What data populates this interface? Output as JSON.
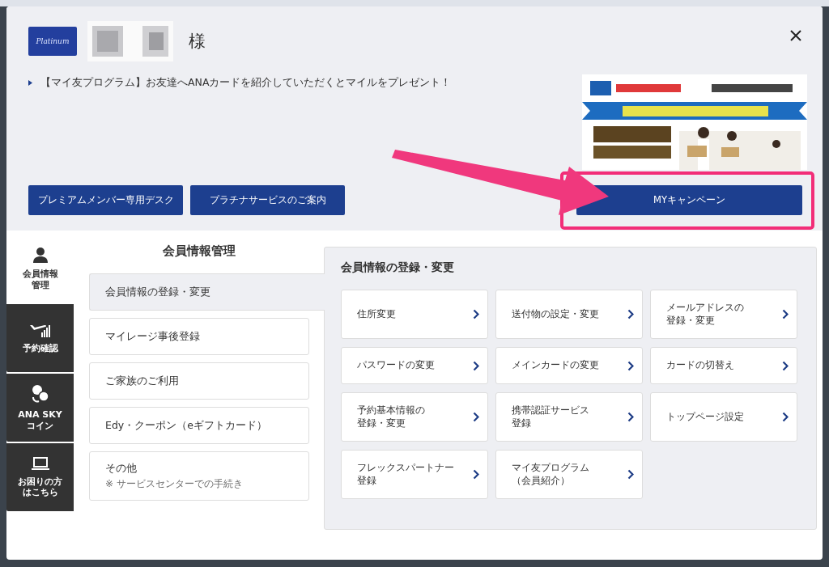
{
  "header": {
    "card_logo": "Platinum",
    "honorific": "様"
  },
  "notice": "【マイ友プログラム】お友達へANAカードを紹介していただくとマイルをプレゼント！",
  "top_buttons": [
    "プレミアムメンバー専用デスク",
    "プラチナサービスのご案内"
  ],
  "campaign_button": "MYキャンペーン",
  "side_tabs": [
    {
      "lines": [
        "会員情報",
        "管理"
      ],
      "kind": "person",
      "selected": true
    },
    {
      "lines": [
        "予約確認"
      ],
      "kind": "flight",
      "selected": false
    },
    {
      "lines": [
        "ANA SKY",
        "コイン"
      ],
      "kind": "coin",
      "selected": false
    },
    {
      "lines": [
        "お困りの方",
        "はこちら"
      ],
      "kind": "laptop",
      "selected": false
    }
  ],
  "menu": {
    "title": "会員情報管理",
    "items": [
      {
        "label": "会員情報の登録・変更",
        "selected": true
      },
      {
        "label": "マイレージ事後登録",
        "selected": false
      },
      {
        "label": "ご家族のご利用",
        "selected": false
      },
      {
        "label": "Edy・クーポン（eギフトカード）",
        "selected": false
      },
      {
        "label": "その他",
        "note": "※ サービスセンターでの手続き",
        "selected": false
      }
    ]
  },
  "panel": {
    "title": "会員情報の登録・変更",
    "links": [
      {
        "lines": [
          "住所変更"
        ]
      },
      {
        "lines": [
          "送付物の設定・変更"
        ]
      },
      {
        "lines": [
          "メールアドレスの",
          "登録・変更"
        ]
      },
      {
        "lines": [
          "パスワードの変更"
        ]
      },
      {
        "lines": [
          "メインカードの変更"
        ]
      },
      {
        "lines": [
          "カードの切替え"
        ]
      },
      {
        "lines": [
          "予約基本情報の",
          "登録・変更"
        ]
      },
      {
        "lines": [
          "携帯認証サービス",
          "登録"
        ]
      },
      {
        "lines": [
          "トップページ設定"
        ]
      },
      {
        "lines": [
          "フレックスパートナー",
          "登録"
        ]
      },
      {
        "lines": [
          "マイ友プログラム",
          "（会員紹介）"
        ]
      }
    ]
  }
}
